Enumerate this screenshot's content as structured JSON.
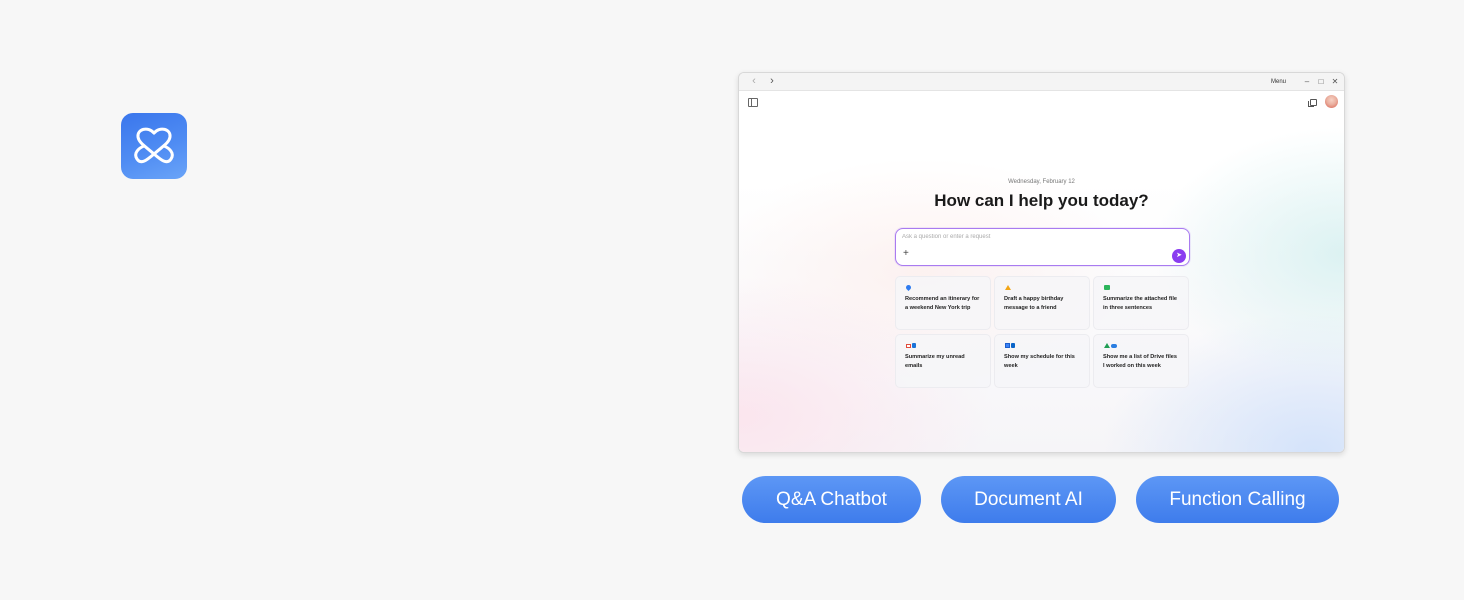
{
  "app": {
    "logo_icon": "knot-logo-icon",
    "accent": "#3e7cec"
  },
  "window": {
    "titlebar": {
      "back_glyph": "‹",
      "forward_glyph": "›",
      "menu_label": "Menu",
      "minimize_glyph": "–",
      "maximize_glyph": "□",
      "close_glyph": "✕"
    },
    "header": {
      "sidebar_icon": "sidebar-toggle-icon",
      "copy_icon": "copy-icon",
      "avatar": "user-avatar"
    },
    "date": "Wednesday, February 12",
    "greeting": "How can I help you today?",
    "prompt": {
      "placeholder": "Ask a question or enter a request",
      "value": "",
      "add_glyph": "+",
      "send_glyph": "➤",
      "accent": "#8a3cf0"
    },
    "suggestions": [
      {
        "icon": "map-pin-icon",
        "text": "Recommend an itinerary for a weekend New York trip"
      },
      {
        "icon": "cake-icon",
        "text": "Draft a happy birthday message to a friend"
      },
      {
        "icon": "folder-icon",
        "text": "Summarize the attached file in three sentences"
      },
      {
        "icon": "gmail-outlook-icon",
        "text": "Summarize my unread emails"
      },
      {
        "icon": "calendar-icon",
        "text": "Show my schedule for this week"
      },
      {
        "icon": "drive-onedrive-icon",
        "text": "Show me a list of Drive files I worked on this week"
      }
    ]
  },
  "features": [
    {
      "label": "Q&A Chatbot"
    },
    {
      "label": "Document AI"
    },
    {
      "label": "Function Calling"
    }
  ]
}
